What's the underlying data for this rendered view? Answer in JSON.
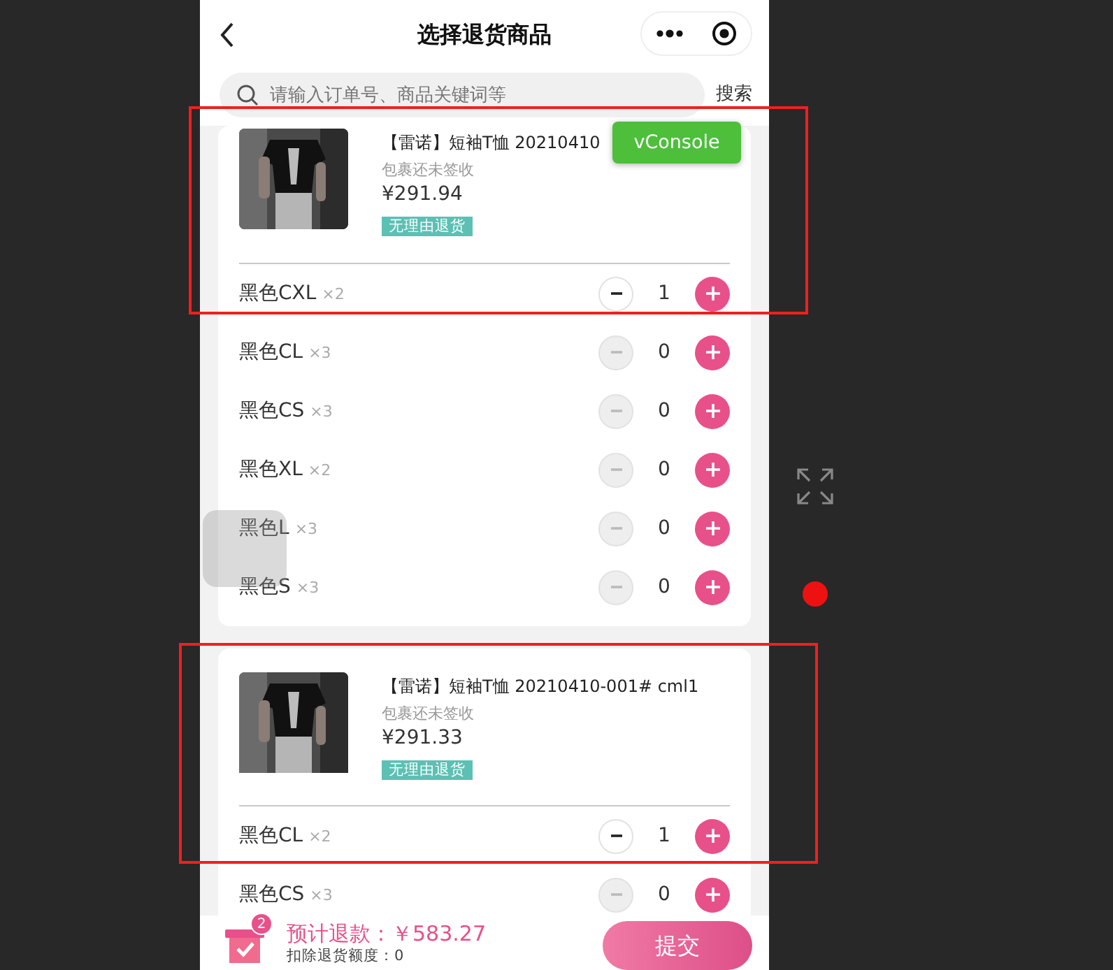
{
  "header": {
    "title": "选择退货商品"
  },
  "search": {
    "placeholder": "请输入订单号、商品关键词等",
    "button": "搜索"
  },
  "orders": [
    {
      "title": "【雷诺】短袖T恤 20210410",
      "status": "包裹还未签收",
      "price": "¥291.94",
      "tag": "无理由退货",
      "variants": [
        {
          "name": "黑色CXL",
          "count": "×2",
          "qty": "1",
          "minus_disabled": false
        },
        {
          "name": "黑色CL",
          "count": "×3",
          "qty": "0",
          "minus_disabled": true
        },
        {
          "name": "黑色CS",
          "count": "×3",
          "qty": "0",
          "minus_disabled": true
        },
        {
          "name": "黑色XL",
          "count": "×2",
          "qty": "0",
          "minus_disabled": true
        },
        {
          "name": "黑色L",
          "count": "×3",
          "qty": "0",
          "minus_disabled": true
        },
        {
          "name": "黑色S",
          "count": "×3",
          "qty": "0",
          "minus_disabled": true
        }
      ]
    },
    {
      "title": "【雷诺】短袖T恤 20210410-001# cml1",
      "status": "包裹还未签收",
      "price": "¥291.33",
      "tag": "无理由退货",
      "variants": [
        {
          "name": "黑色CL",
          "count": "×2",
          "qty": "1",
          "minus_disabled": false
        },
        {
          "name": "黑色CS",
          "count": "×3",
          "qty": "0",
          "minus_disabled": true
        }
      ]
    }
  ],
  "footer": {
    "cart_badge": "2",
    "refund": "预计退款：￥583.27",
    "deduction": "扣除退货额度：0",
    "submit": "提交"
  },
  "debug_button": "vConsole"
}
